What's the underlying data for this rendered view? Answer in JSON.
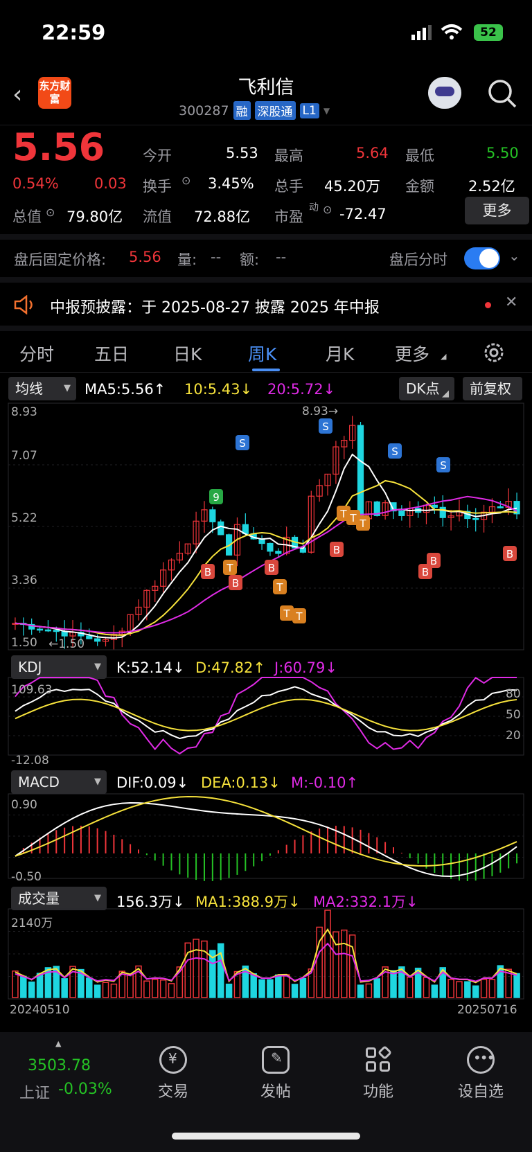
{
  "status": {
    "time": "22:59",
    "battery": "52"
  },
  "header": {
    "title": "飞利信",
    "code": "300287",
    "tags": [
      "融",
      "深股通",
      "L1"
    ],
    "logo": "东方财富"
  },
  "quote": {
    "price": "5.56",
    "pct": "0.54%",
    "chg": "0.03",
    "open_label": "今开",
    "open": "5.53",
    "high_label": "最高",
    "high": "5.64",
    "low_label": "最低",
    "low": "5.50",
    "turnover_label": "换手",
    "turnover": "3.45%",
    "vol_label": "总手",
    "vol": "45.20万",
    "amt_label": "金额",
    "amt": "2.52亿",
    "mcap_label": "总值",
    "mcap": "79.80亿",
    "float_label": "流值",
    "float": "72.88亿",
    "pe_label": "市盈",
    "pe_sup": "动",
    "pe": "-72.47",
    "more": "更多"
  },
  "post": {
    "label": "盘后固定价格:",
    "price": "5.56",
    "vol_label": "量:",
    "vol": "--",
    "amt_label": "额:",
    "amt": "--",
    "toggle_label": "盘后分时"
  },
  "notice": {
    "text": "中报预披露：于 2025-08-27 披露 2025 年中报"
  },
  "tabs": [
    "分时",
    "五日",
    "日K",
    "周K",
    "月K",
    "更多"
  ],
  "ma": {
    "selector": "均线",
    "ma5": "MA5:5.56↑",
    "ma10": "10:5.43↓",
    "ma20": "20:5.72↓",
    "dk": "DK点",
    "fq": "前复权"
  },
  "price_axis": {
    "top": "8.93",
    "l2": "7.07",
    "l3": "5.22",
    "l4": "3.36",
    "bottom": "1.50",
    "max_label": "8.93→",
    "min_label": "←1.50"
  },
  "kdj": {
    "selector": "KDJ",
    "k": "K:52.14↓",
    "d": "D:47.82↑",
    "j": "J:60.79↓",
    "top": "109.63",
    "bottom": "-12.08",
    "r80": "80",
    "r50": "50",
    "r20": "20"
  },
  "macd": {
    "selector": "MACD",
    "dif": "DIF:0.09↓",
    "dea": "DEA:0.13↓",
    "m": "M:-0.10↑",
    "top": "0.90",
    "bottom": "-0.50"
  },
  "volume": {
    "selector": "成交量",
    "v": "156.3万↓",
    "ma1": "MA1:388.9万↓",
    "ma2": "MA2:332.1万↓",
    "top": "2140万",
    "start": "20240510",
    "end": "20250716"
  },
  "nav": {
    "index_value": "3503.78",
    "index_name": "上证",
    "index_pct": "-0.03%",
    "items": [
      "交易",
      "发帖",
      "功能",
      "设自选"
    ]
  },
  "colors": {
    "up": "#f0353a",
    "down": "#25c225",
    "accent": "#4a8ff5",
    "bull": "#1ed6e0",
    "ma5": "#ffffff",
    "ma10": "#f6e23c",
    "ma20": "#e02be6"
  }
}
